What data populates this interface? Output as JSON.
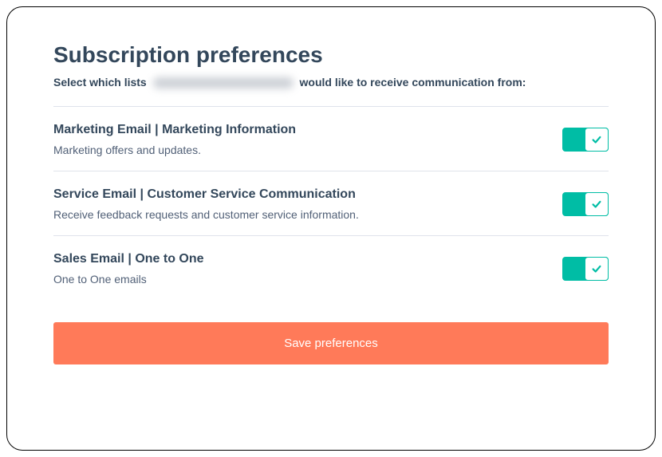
{
  "header": {
    "title": "Subscription preferences",
    "subtitle_prefix": "Select which lists",
    "subtitle_suffix": "would like to receive communication from:"
  },
  "items": [
    {
      "title": "Marketing Email | Marketing Information",
      "description": "Marketing offers and updates.",
      "on": true
    },
    {
      "title": "Service Email | Customer Service Communication",
      "description": "Receive feedback requests and customer service information.",
      "on": true
    },
    {
      "title": "Sales Email | One to One",
      "description": "One to One emails",
      "on": true
    }
  ],
  "actions": {
    "save_label": "Save preferences"
  },
  "colors": {
    "accent": "#00bda5",
    "primary_button": "#ff7a59",
    "text": "#33475b"
  }
}
